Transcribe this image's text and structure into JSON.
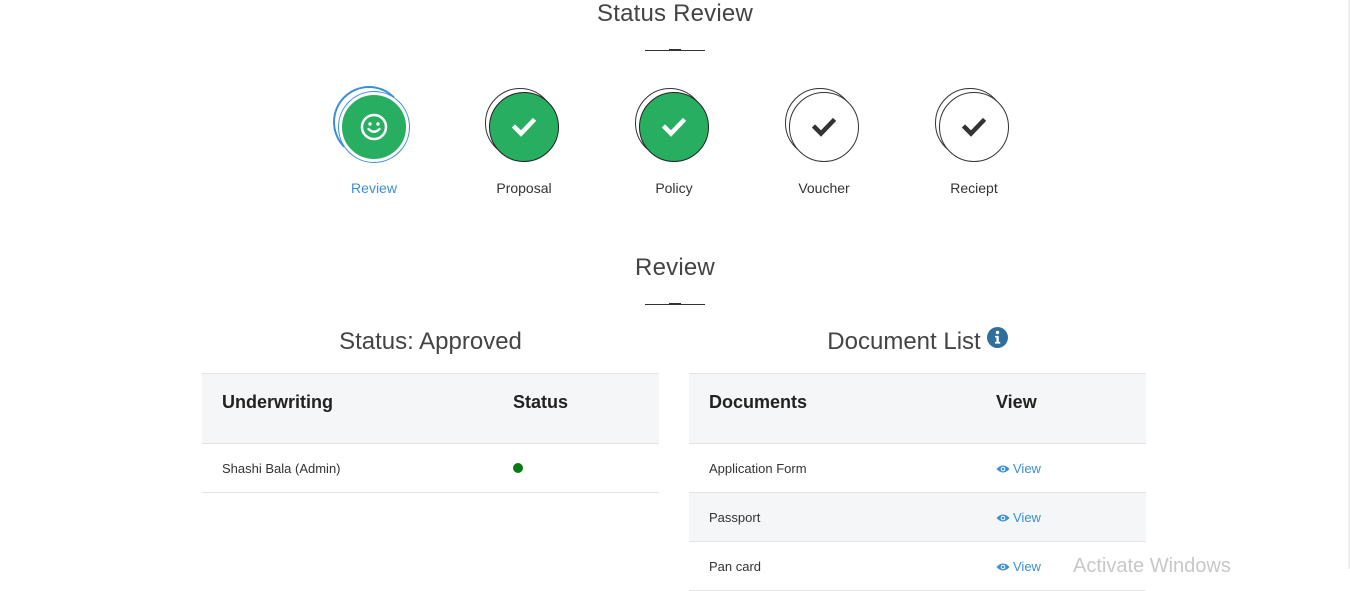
{
  "page": {
    "title": "Status Review"
  },
  "steps": [
    {
      "label": "Review",
      "state": "active",
      "icon": "smile-icon"
    },
    {
      "label": "Proposal",
      "state": "done",
      "icon": "check-icon"
    },
    {
      "label": "Policy",
      "state": "done",
      "icon": "check-icon"
    },
    {
      "label": "Voucher",
      "state": "pending",
      "icon": "check-icon"
    },
    {
      "label": "Reciept",
      "state": "pending",
      "icon": "check-icon"
    }
  ],
  "review": {
    "title": "Review",
    "status_panel": {
      "title": "Status: Approved",
      "columns": [
        "Underwriting",
        "Status"
      ],
      "rows": [
        {
          "name": "Shashi Bala (Admin)",
          "status": "approved",
          "status_color": "#0a7a12"
        }
      ]
    },
    "documents_panel": {
      "title": "Document List",
      "info_icon": "info-icon",
      "columns": [
        "Documents",
        "View"
      ],
      "rows": [
        {
          "name": "Application Form",
          "action": "View"
        },
        {
          "name": "Passport",
          "action": "View"
        },
        {
          "name": "Pan card",
          "action": "View"
        }
      ]
    }
  },
  "colors": {
    "success": "#27ae60",
    "accent": "#3b8fd6",
    "header_bg": "#f5f6f7"
  },
  "watermark": "Activate Windows"
}
